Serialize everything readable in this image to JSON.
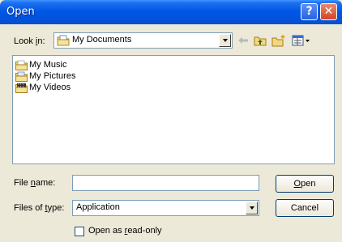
{
  "window": {
    "title": "Open"
  },
  "toolbar": {
    "look_in_label_pre": "Look ",
    "look_in_label_key": "i",
    "look_in_label_post": "n:",
    "look_in_value": "My Documents"
  },
  "files": [
    {
      "name": "My Music",
      "icon": "music-folder-icon"
    },
    {
      "name": "My Pictures",
      "icon": "pictures-folder-icon"
    },
    {
      "name": "My Videos",
      "icon": "videos-folder-icon"
    }
  ],
  "form": {
    "file_name_pre": "File ",
    "file_name_key": "n",
    "file_name_post": "ame:",
    "file_name_value": "",
    "files_of_type_pre": "Files of ",
    "files_of_type_key": "t",
    "files_of_type_post": "ype:",
    "files_of_type_value": "Application",
    "readonly_pre": "Open as ",
    "readonly_key": "r",
    "readonly_post": "ead-only",
    "readonly_checked": false
  },
  "buttons": {
    "open_key": "O",
    "open_rest": "pen",
    "cancel": "Cancel"
  },
  "colors": {
    "titlebar": "#0058e6",
    "dialog_bg": "#ece9d8",
    "field_border": "#7f9db9"
  }
}
